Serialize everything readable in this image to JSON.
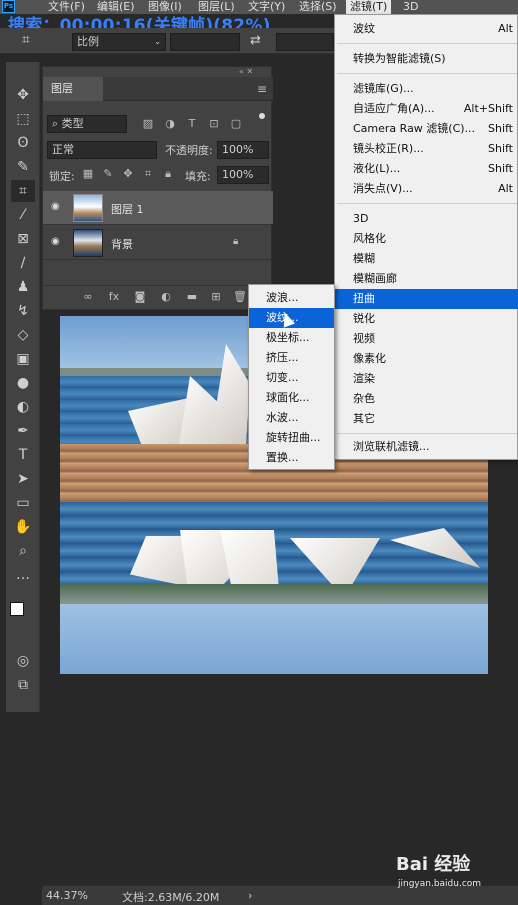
{
  "overlay_caption": "搜索：00:00:16(关键帧)(82%)",
  "app": {
    "logo": "Ps"
  },
  "menubar": {
    "items": [
      "文件(F)",
      "编辑(E)",
      "图像(I)",
      "图层(L)",
      "文字(Y)",
      "选择(S)",
      "滤镜(T)",
      "3D"
    ]
  },
  "options_bar": {
    "ratio_select": "比例",
    "swap_icon": "swap-icon"
  },
  "toolbar": {
    "tools": [
      "move-icon",
      "marquee-icon",
      "lasso-icon",
      "quick-select-icon",
      "crop-icon",
      "eyedropper-icon",
      "frame-icon",
      "brush-icon",
      "stamp-icon",
      "history-brush-icon",
      "eraser-icon",
      "gradient-icon",
      "blur-icon",
      "dodge-icon",
      "pen-icon",
      "type-icon",
      "path-select-icon",
      "rectangle-icon",
      "hand-icon",
      "zoom-icon",
      "more-icon"
    ]
  },
  "layers_panel": {
    "tab_label": "图层",
    "filter_type": "类型",
    "blend_mode": "正常",
    "opacity_label": "不透明度:",
    "opacity_value": "100%",
    "lock_label": "锁定:",
    "fill_label": "填充:",
    "fill_value": "100%",
    "layers": [
      {
        "name": "图层 1",
        "selected": true,
        "locked": false
      },
      {
        "name": "背景",
        "selected": false,
        "locked": true
      }
    ],
    "bottom_icons": [
      "link-icon",
      "fx-icon",
      "mask-icon",
      "adjustment-icon",
      "group-icon",
      "new-layer-icon",
      "trash-icon"
    ]
  },
  "filter_menu": {
    "items": [
      {
        "label": "波纹",
        "shortcut": "Alt"
      },
      {
        "label": "转换为智能滤镜(S)",
        "shortcut": ""
      },
      {
        "label": "滤镜库(G)...",
        "shortcut": ""
      },
      {
        "label": "自适应广角(A)...",
        "shortcut": "Alt+Shift"
      },
      {
        "label": "Camera Raw 滤镜(C)...",
        "shortcut": "Shift"
      },
      {
        "label": "镜头校正(R)...",
        "shortcut": "Shift"
      },
      {
        "label": "液化(L)...",
        "shortcut": "Shift"
      },
      {
        "label": "消失点(V)...",
        "shortcut": "Alt"
      },
      {
        "label": "3D",
        "shortcut": ""
      },
      {
        "label": "风格化",
        "shortcut": ""
      },
      {
        "label": "模糊",
        "shortcut": ""
      },
      {
        "label": "模糊画廊",
        "shortcut": ""
      },
      {
        "label": "扭曲",
        "shortcut": ""
      },
      {
        "label": "锐化",
        "shortcut": ""
      },
      {
        "label": "视频",
        "shortcut": ""
      },
      {
        "label": "像素化",
        "shortcut": ""
      },
      {
        "label": "渲染",
        "shortcut": ""
      },
      {
        "label": "杂色",
        "shortcut": ""
      },
      {
        "label": "其它",
        "shortcut": ""
      },
      {
        "label": "浏览联机滤镜...",
        "shortcut": ""
      }
    ],
    "highlighted": "扭曲"
  },
  "distort_submenu": {
    "items": [
      "波浪...",
      "波纹...",
      "极坐标...",
      "挤压...",
      "切变...",
      "球面化...",
      "水波...",
      "旋转扭曲...",
      "置换..."
    ],
    "highlighted": "波纹..."
  },
  "status_bar": {
    "zoom": "44.37%",
    "doc_info": "文档:2.63M/6.20M"
  },
  "watermark": {
    "brand": "Bai 经验",
    "url": "jingyan.baidu.com"
  },
  "colors": {
    "menu_highlight": "#0a64d8",
    "caption": "#3b7ff2",
    "panel_bg": "#424242"
  }
}
